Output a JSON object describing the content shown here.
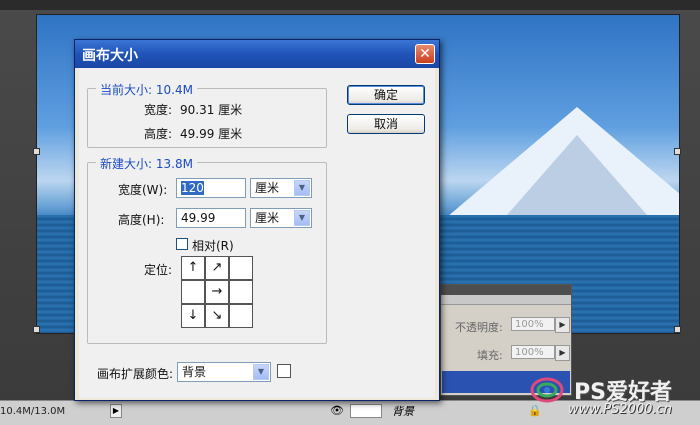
{
  "dialog": {
    "title": "画布大小",
    "current_size": {
      "legend": "当前大小: 10.4M",
      "width_label": "宽度:",
      "width_value": "90.31 厘米",
      "height_label": "高度:",
      "height_value": "49.99 厘米"
    },
    "new_size": {
      "legend": "新建大小: 13.8M",
      "width_label": "宽度(W):",
      "width_value": "120",
      "width_unit": "厘米",
      "height_label": "高度(H):",
      "height_value": "49.99",
      "height_unit": "厘米",
      "relative_label": "相对(R)",
      "relative_checked": false,
      "anchor_label": "定位:",
      "anchor_arrows": [
        "↑",
        "↗",
        "",
        "",
        "→",
        "",
        "↓",
        "↘",
        ""
      ]
    },
    "extension_color_label": "画布扩展颜色:",
    "extension_color_value": "背景",
    "ok_label": "确定",
    "cancel_label": "取消"
  },
  "layers_panel": {
    "opacity_label": "不透明度:",
    "opacity_value": "100%",
    "fill_label": "填充:",
    "fill_value": "100%"
  },
  "statusbar": {
    "size_text": "10.4M/13.0M",
    "layer_name": "背景"
  },
  "watermark": {
    "brand": "PS爱好者",
    "url": "www.PS2000.cn"
  },
  "icons": {
    "close": "close-icon",
    "dropdown": "chevron-down-icon",
    "eye": "eye-icon",
    "lock": "lock-icon"
  }
}
